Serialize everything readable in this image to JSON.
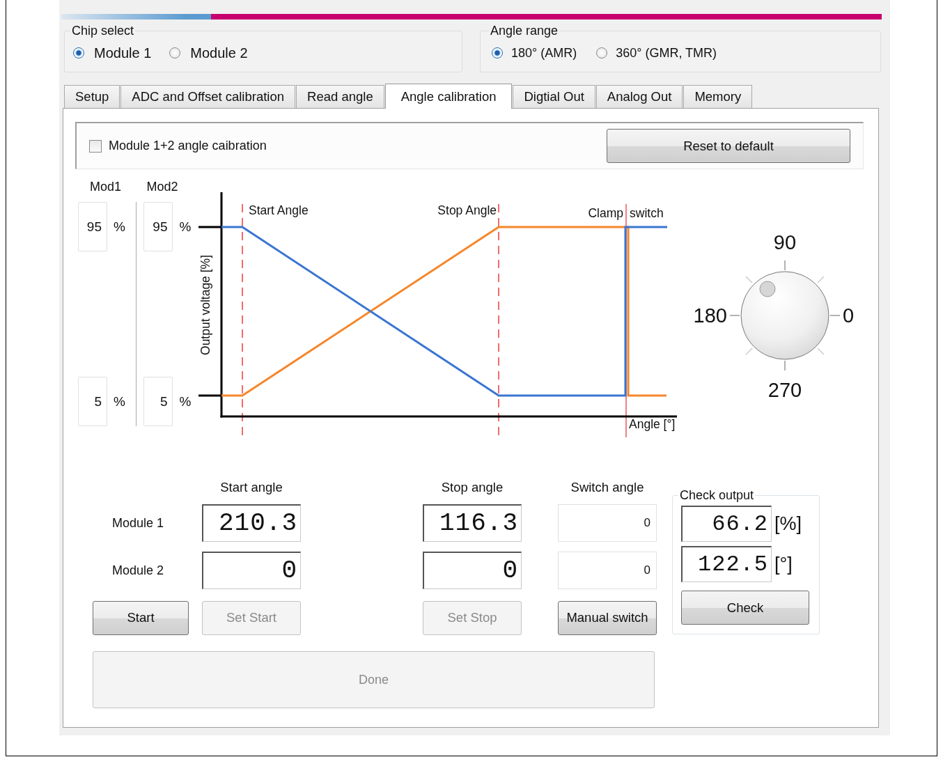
{
  "chip_select": {
    "title": "Chip select",
    "options": [
      {
        "label": "Module 1",
        "selected": true
      },
      {
        "label": "Module 2",
        "selected": false
      }
    ]
  },
  "angle_range": {
    "title": "Angle range",
    "options": [
      {
        "label": "180° (AMR)",
        "selected": true
      },
      {
        "label": "360° (GMR, TMR)",
        "selected": false
      }
    ]
  },
  "tabs": [
    {
      "label": "Setup",
      "selected": false
    },
    {
      "label": "ADC and Offset calibration",
      "selected": false
    },
    {
      "label": "Read angle",
      "selected": false
    },
    {
      "label": "Angle calibration",
      "selected": true
    },
    {
      "label": "Digtial Out",
      "selected": false
    },
    {
      "label": "Analog Out",
      "selected": false
    },
    {
      "label": "Memory",
      "selected": false
    }
  ],
  "calibration": {
    "checkbox": {
      "label": "Module 1+2 angle caibration",
      "checked": false
    },
    "reset_button": "Reset to default"
  },
  "limits": [
    {
      "heading": "Mod1",
      "high": "95",
      "high_unit": "%",
      "low": "5",
      "low_unit": "%"
    },
    {
      "heading": "Mod2",
      "high": "95",
      "high_unit": "%",
      "low": "5",
      "low_unit": "%"
    }
  ],
  "graph": {
    "y_label": "Output voltage [%]",
    "x_label": "Angle [°]",
    "markers": [
      "Start Angle",
      "Stop Angle",
      "Clamp",
      "switch"
    ]
  },
  "dial": {
    "labels": [
      "90",
      "180",
      "0",
      "270"
    ]
  },
  "angles": {
    "headings": [
      "Start angle",
      "Stop angle",
      "Switch angle"
    ],
    "rows": [
      {
        "label": "Module 1",
        "start": "210.3",
        "stop": "116.3",
        "switch": "0"
      },
      {
        "label": "Module 2",
        "start": "0",
        "stop": "0",
        "switch": "0"
      }
    ]
  },
  "buttons": [
    {
      "label": "Start",
      "disabled": false
    },
    {
      "label": "Set Start",
      "disabled": true
    },
    {
      "label": "Set Stop",
      "disabled": true
    },
    {
      "label": "Manual switch",
      "disabled": false
    }
  ],
  "check_output": {
    "title": "Check output",
    "readings": [
      {
        "value": "66.2",
        "unit": "[%]"
      },
      {
        "value": "122.5",
        "unit": "[°]"
      }
    ],
    "button": "Check"
  },
  "done_button": {
    "label": "Done",
    "disabled": true
  }
}
